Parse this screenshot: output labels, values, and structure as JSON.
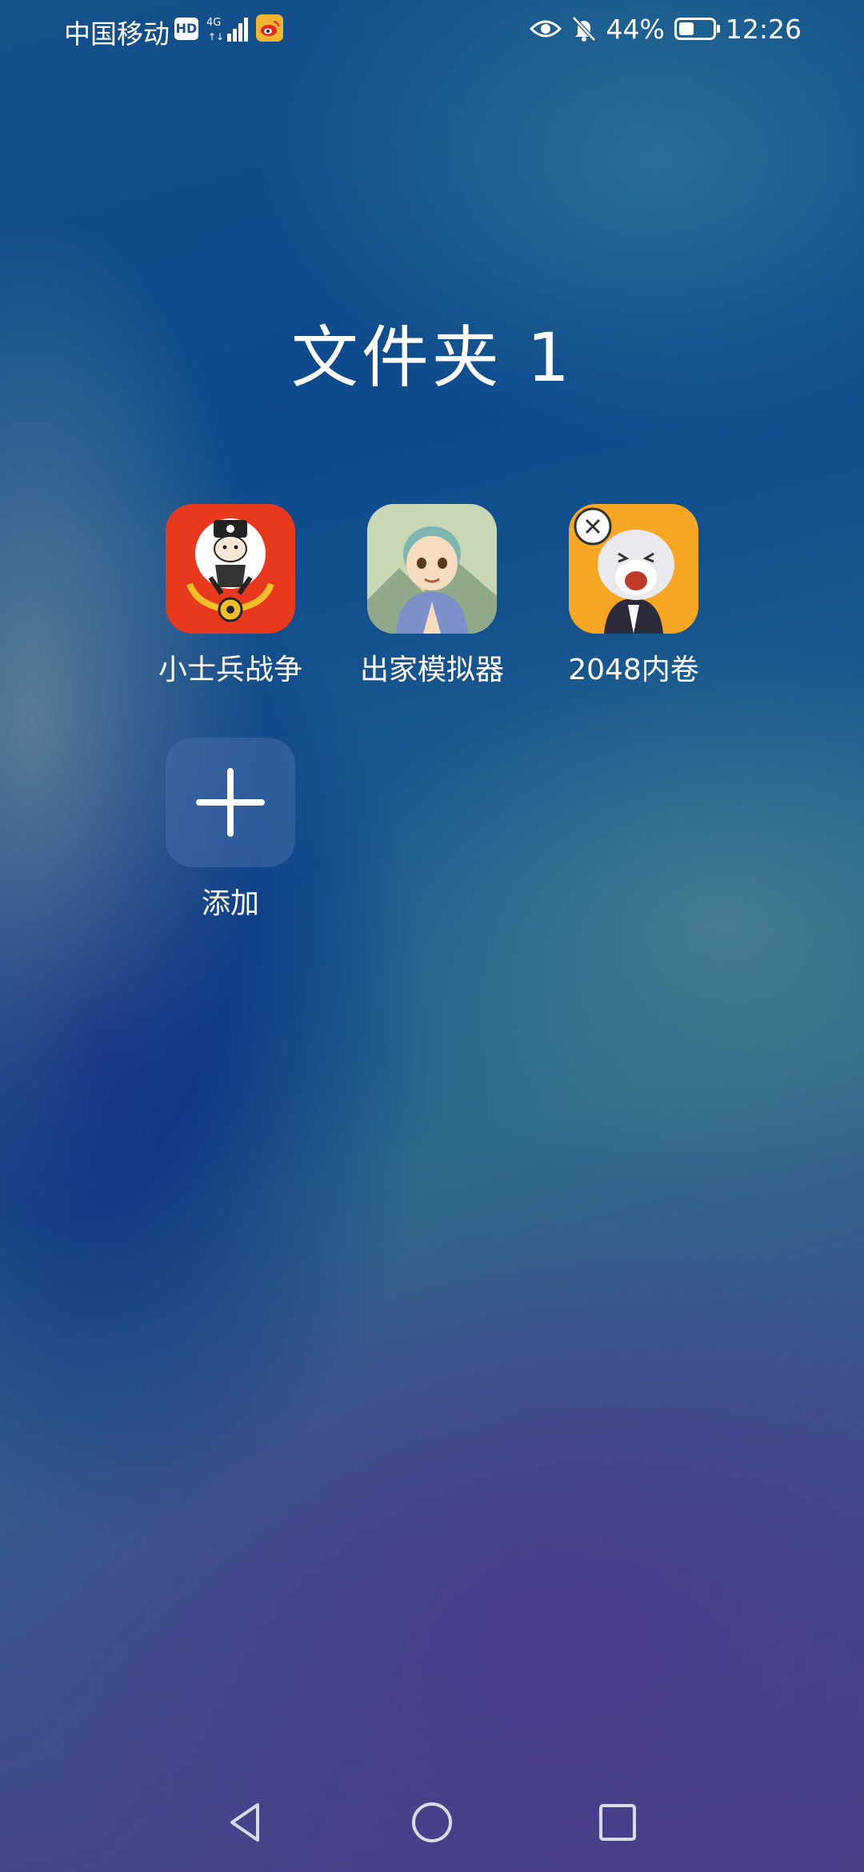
{
  "status_bar": {
    "carrier": "中国移动",
    "hd": "HD",
    "network": "4G",
    "battery_pct": "44%",
    "battery_level": 0.44,
    "time": "12:26",
    "icons": [
      "hd-icon",
      "signal-icon",
      "weibo-icon",
      "eye-icon",
      "bell-muted-icon",
      "battery-icon"
    ]
  },
  "folder": {
    "title": "文件夹 1",
    "apps": [
      {
        "label": "小士兵战争",
        "icon": "soldier-war-icon"
      },
      {
        "label": "出家模拟器",
        "icon": "monk-simulator-icon"
      },
      {
        "label": "2048内卷",
        "icon": "hamster-2048-icon"
      }
    ],
    "add": {
      "label": "添加",
      "icon": "plus-icon"
    }
  },
  "nav_bar": {
    "buttons": [
      "back-icon",
      "home-icon",
      "recent-apps-icon"
    ]
  },
  "colors": {
    "text": "#ffffff",
    "soldier_bg": "#e8391f",
    "hamster_bg": "#f5a623",
    "monk_bg": "#a9c3a0"
  }
}
